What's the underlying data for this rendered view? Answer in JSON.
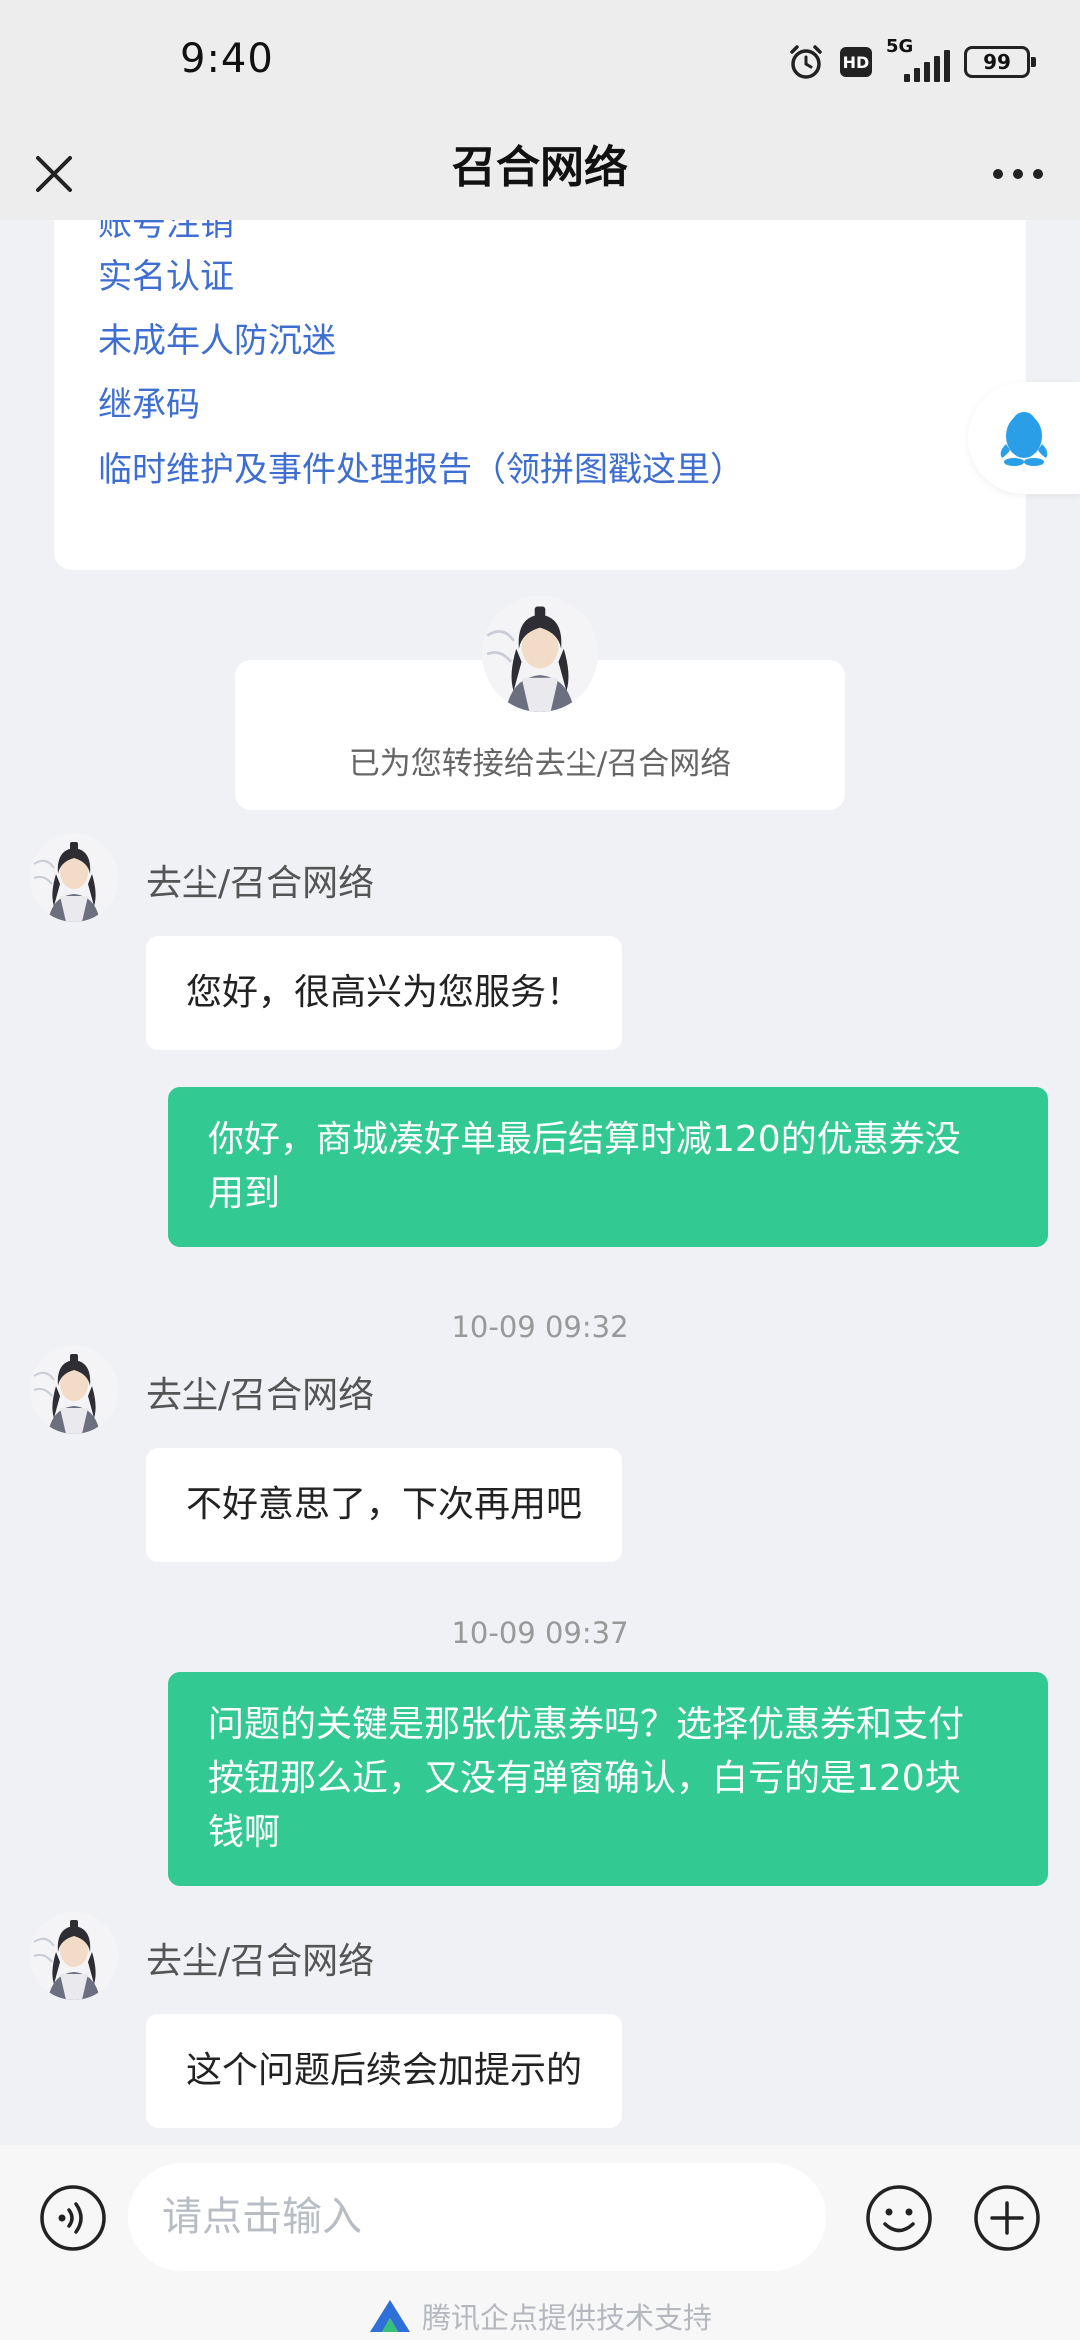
{
  "status_bar": {
    "time": "9:40",
    "network": "5G",
    "hd_label": "HD",
    "battery": "99",
    "icons": [
      "alarm-icon",
      "hd-icon",
      "signal-icon",
      "battery-icon"
    ]
  },
  "nav": {
    "title": "召合网络",
    "close_icon": "close-icon",
    "more_icon": "more-icon"
  },
  "menu_links": [
    "账号注销",
    "实名认证",
    "未成年人防沉迷",
    "继承码",
    "临时维护及事件处理报告（领拼图戳这里）"
  ],
  "transfer_notice": "已为您转接给去尘/召合网络",
  "messages": [
    {
      "type": "in",
      "sender": "去尘/召合网络",
      "text": "您好，很高兴为您服务！"
    },
    {
      "type": "out",
      "lines": [
        "你好，商城凑好单最后结算时减120的优惠券没",
        "用到"
      ]
    },
    {
      "type": "time",
      "text": "10-09 09:32"
    },
    {
      "type": "in",
      "sender": "去尘/召合网络",
      "text": "不好意思了，下次再用吧"
    },
    {
      "type": "time",
      "text": "10-09 09:37"
    },
    {
      "type": "out",
      "lines": [
        "问题的关键是那张优惠券吗？选择优惠券和支付",
        "按钮那么近，又没有弹窗确认，白亏的是120块",
        "钱啊"
      ]
    },
    {
      "type": "in",
      "sender": "去尘/召合网络",
      "text": "这个问题后续会加提示的"
    }
  ],
  "input": {
    "placeholder": "请点击输入",
    "value": ""
  },
  "support_text": "腾讯企点提供技术支持",
  "colors": {
    "accent_green": "#33c993",
    "link_blue": "#3f6ed1",
    "background": "#f0f1f4"
  }
}
